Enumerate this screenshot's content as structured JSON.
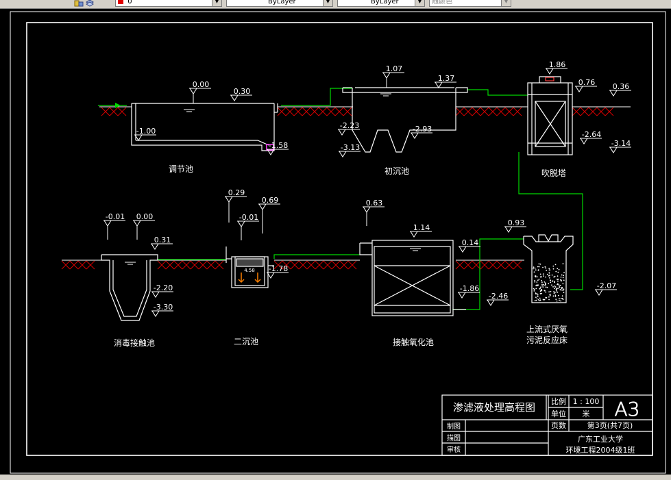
{
  "toolbar": {
    "layer_value": "0",
    "linetype_value": "ByLayer",
    "lineweight_value": "ByLayer",
    "plotstyle_value": "随颜色"
  },
  "colors": {
    "background": "#000000",
    "lines": "#ffffff",
    "water_pipe": "#00d800",
    "ground_hatch": "#d40000",
    "valve": "#ff40ff"
  },
  "units": {
    "tiaojie": {
      "name": "调节池",
      "elevations": [
        "0.00",
        "0.30",
        "-1.00",
        "-1.58"
      ]
    },
    "chuchen": {
      "name": "初沉池",
      "elevations": [
        "1.07",
        "1.37",
        "-2.23",
        "-2.93",
        "-3.13"
      ]
    },
    "chuituo": {
      "name": "吹脱塔",
      "elevations": [
        "1.86",
        "0.76",
        "0.36",
        "-2.64",
        "-3.14"
      ]
    },
    "xiaodu": {
      "name": "消毒接触池",
      "elevations": [
        "-0.01",
        "0.00",
        "0.31",
        "-2.20",
        "-3.30"
      ]
    },
    "erchen": {
      "name": "二沉池",
      "elevations": [
        "0.29",
        "-0.01",
        "0.69",
        "-1.78"
      ],
      "inner_note": "4.58"
    },
    "jiechu": {
      "name": "接触氧化池",
      "elevations": [
        "0.63",
        "1.14",
        "0.14",
        "-1.86",
        "-2.46"
      ]
    },
    "uasb": {
      "name_line1": "上流式厌氧",
      "name_line2": "污泥反应床",
      "elevations": [
        "0.93",
        "-2.07"
      ]
    }
  },
  "title_block": {
    "title": "渗滤液处理高程图",
    "scale_label": "比例",
    "scale_value": "1 : 100",
    "unit_label": "单位",
    "unit_value": "米",
    "page_label": "页数",
    "page_value": "第3页(共7页)",
    "sheet_size": "A3",
    "row_zhitu": "制图",
    "row_miaotu": "描图",
    "row_shenhe": "审核",
    "org_line1": "广东工业大学",
    "org_line2": "环境工程2004级1班"
  }
}
